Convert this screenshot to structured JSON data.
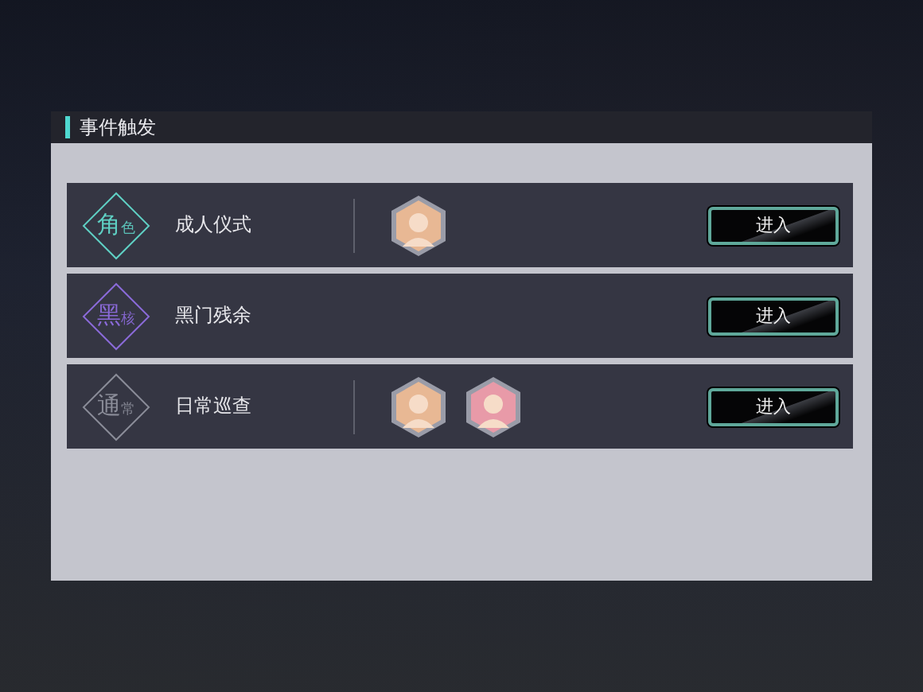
{
  "dialog": {
    "title": "事件触发"
  },
  "events": [
    {
      "tag_main": "角",
      "tag_sub": "色",
      "color": "#5fd0c4",
      "name": "成人仪式",
      "avatars": [
        {
          "color": "#e8b894"
        }
      ],
      "button": "进入"
    },
    {
      "tag_main": "黑",
      "tag_sub": "核",
      "color": "#8a6ad8",
      "name": "黑门残余",
      "button": "进入"
    },
    {
      "tag_main": "通",
      "tag_sub": "常",
      "color": "#8a8c98",
      "name": "日常巡查",
      "avatars": [
        {
          "color": "#e8b894"
        },
        {
          "color": "#e89aa8"
        }
      ],
      "button": "进入"
    }
  ]
}
